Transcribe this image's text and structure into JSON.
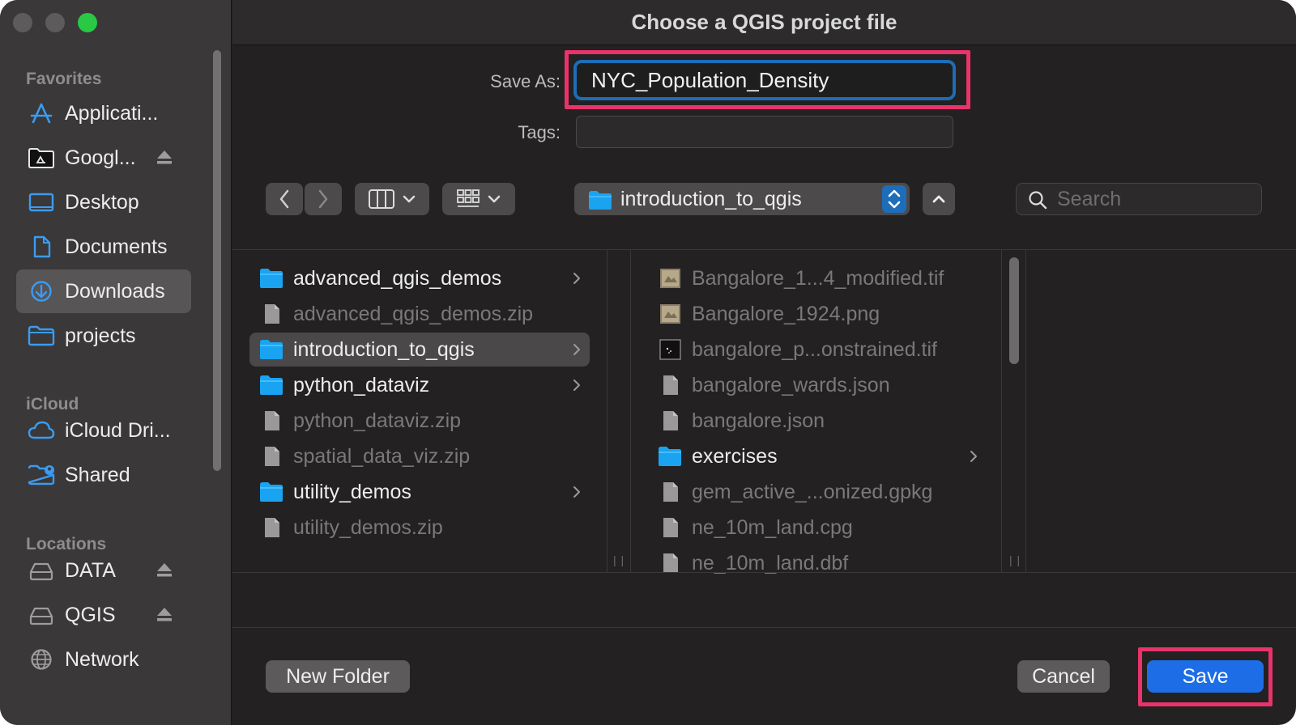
{
  "dialog": {
    "title": "Choose a QGIS project file"
  },
  "colors": {
    "accent": "#1d6db8",
    "highlight": "#e8336b",
    "save_button": "#1d6ee6",
    "folder": "#1aa3f0"
  },
  "sidebar": {
    "sections": [
      {
        "label": "Favorites"
      },
      {
        "label": "iCloud"
      },
      {
        "label": "Locations"
      }
    ],
    "favorites": [
      {
        "label": "Applicati...",
        "icon": "applications-icon"
      },
      {
        "label": "Googl...",
        "icon": "google-drive-icon",
        "ejectable": true
      },
      {
        "label": "Desktop",
        "icon": "desktop-icon"
      },
      {
        "label": "Documents",
        "icon": "document-icon"
      },
      {
        "label": "Downloads",
        "icon": "downloads-icon",
        "selected": true
      },
      {
        "label": "projects",
        "icon": "folder-icon"
      }
    ],
    "icloud": [
      {
        "label": "iCloud Dri...",
        "icon": "cloud-icon"
      },
      {
        "label": "Shared",
        "icon": "shared-folder-icon"
      }
    ],
    "locations": [
      {
        "label": "DATA",
        "icon": "drive-icon",
        "ejectable": true
      },
      {
        "label": "QGIS",
        "icon": "drive-icon",
        "ejectable": true
      },
      {
        "label": "Network",
        "icon": "globe-icon"
      }
    ]
  },
  "form": {
    "save_as_label": "Save As:",
    "save_as_value": "NYC_Population_Density",
    "tags_label": "Tags:",
    "tags_value": ""
  },
  "toolbar": {
    "current_folder": "introduction_to_qgis",
    "search_placeholder": "Search"
  },
  "browser": {
    "column1": [
      {
        "label": "advanced_qgis_demos",
        "type": "folder",
        "enabled": true
      },
      {
        "label": "advanced_qgis_demos.zip",
        "type": "file",
        "enabled": false
      },
      {
        "label": "introduction_to_qgis",
        "type": "folder",
        "enabled": true,
        "selected": true
      },
      {
        "label": "python_dataviz",
        "type": "folder",
        "enabled": true
      },
      {
        "label": "python_dataviz.zip",
        "type": "file",
        "enabled": false
      },
      {
        "label": "spatial_data_viz.zip",
        "type": "file",
        "enabled": false
      },
      {
        "label": "utility_demos",
        "type": "folder",
        "enabled": true
      },
      {
        "label": "utility_demos.zip",
        "type": "file",
        "enabled": false
      }
    ],
    "column2": [
      {
        "label": "Bangalore_1...4_modified.tif",
        "type": "image",
        "enabled": false
      },
      {
        "label": "Bangalore_1924.png",
        "type": "image",
        "enabled": false
      },
      {
        "label": "bangalore_p...onstrained.tif",
        "type": "raster",
        "enabled": false
      },
      {
        "label": "bangalore_wards.json",
        "type": "file",
        "enabled": false
      },
      {
        "label": "bangalore.json",
        "type": "file",
        "enabled": false
      },
      {
        "label": "exercises",
        "type": "folder",
        "enabled": true
      },
      {
        "label": "gem_active_...onized.gpkg",
        "type": "file",
        "enabled": false
      },
      {
        "label": "ne_10m_land.cpg",
        "type": "file",
        "enabled": false
      },
      {
        "label": "ne_10m_land.dbf",
        "type": "file",
        "enabled": false
      }
    ]
  },
  "buttons": {
    "new_folder": "New Folder",
    "cancel": "Cancel",
    "save": "Save"
  }
}
